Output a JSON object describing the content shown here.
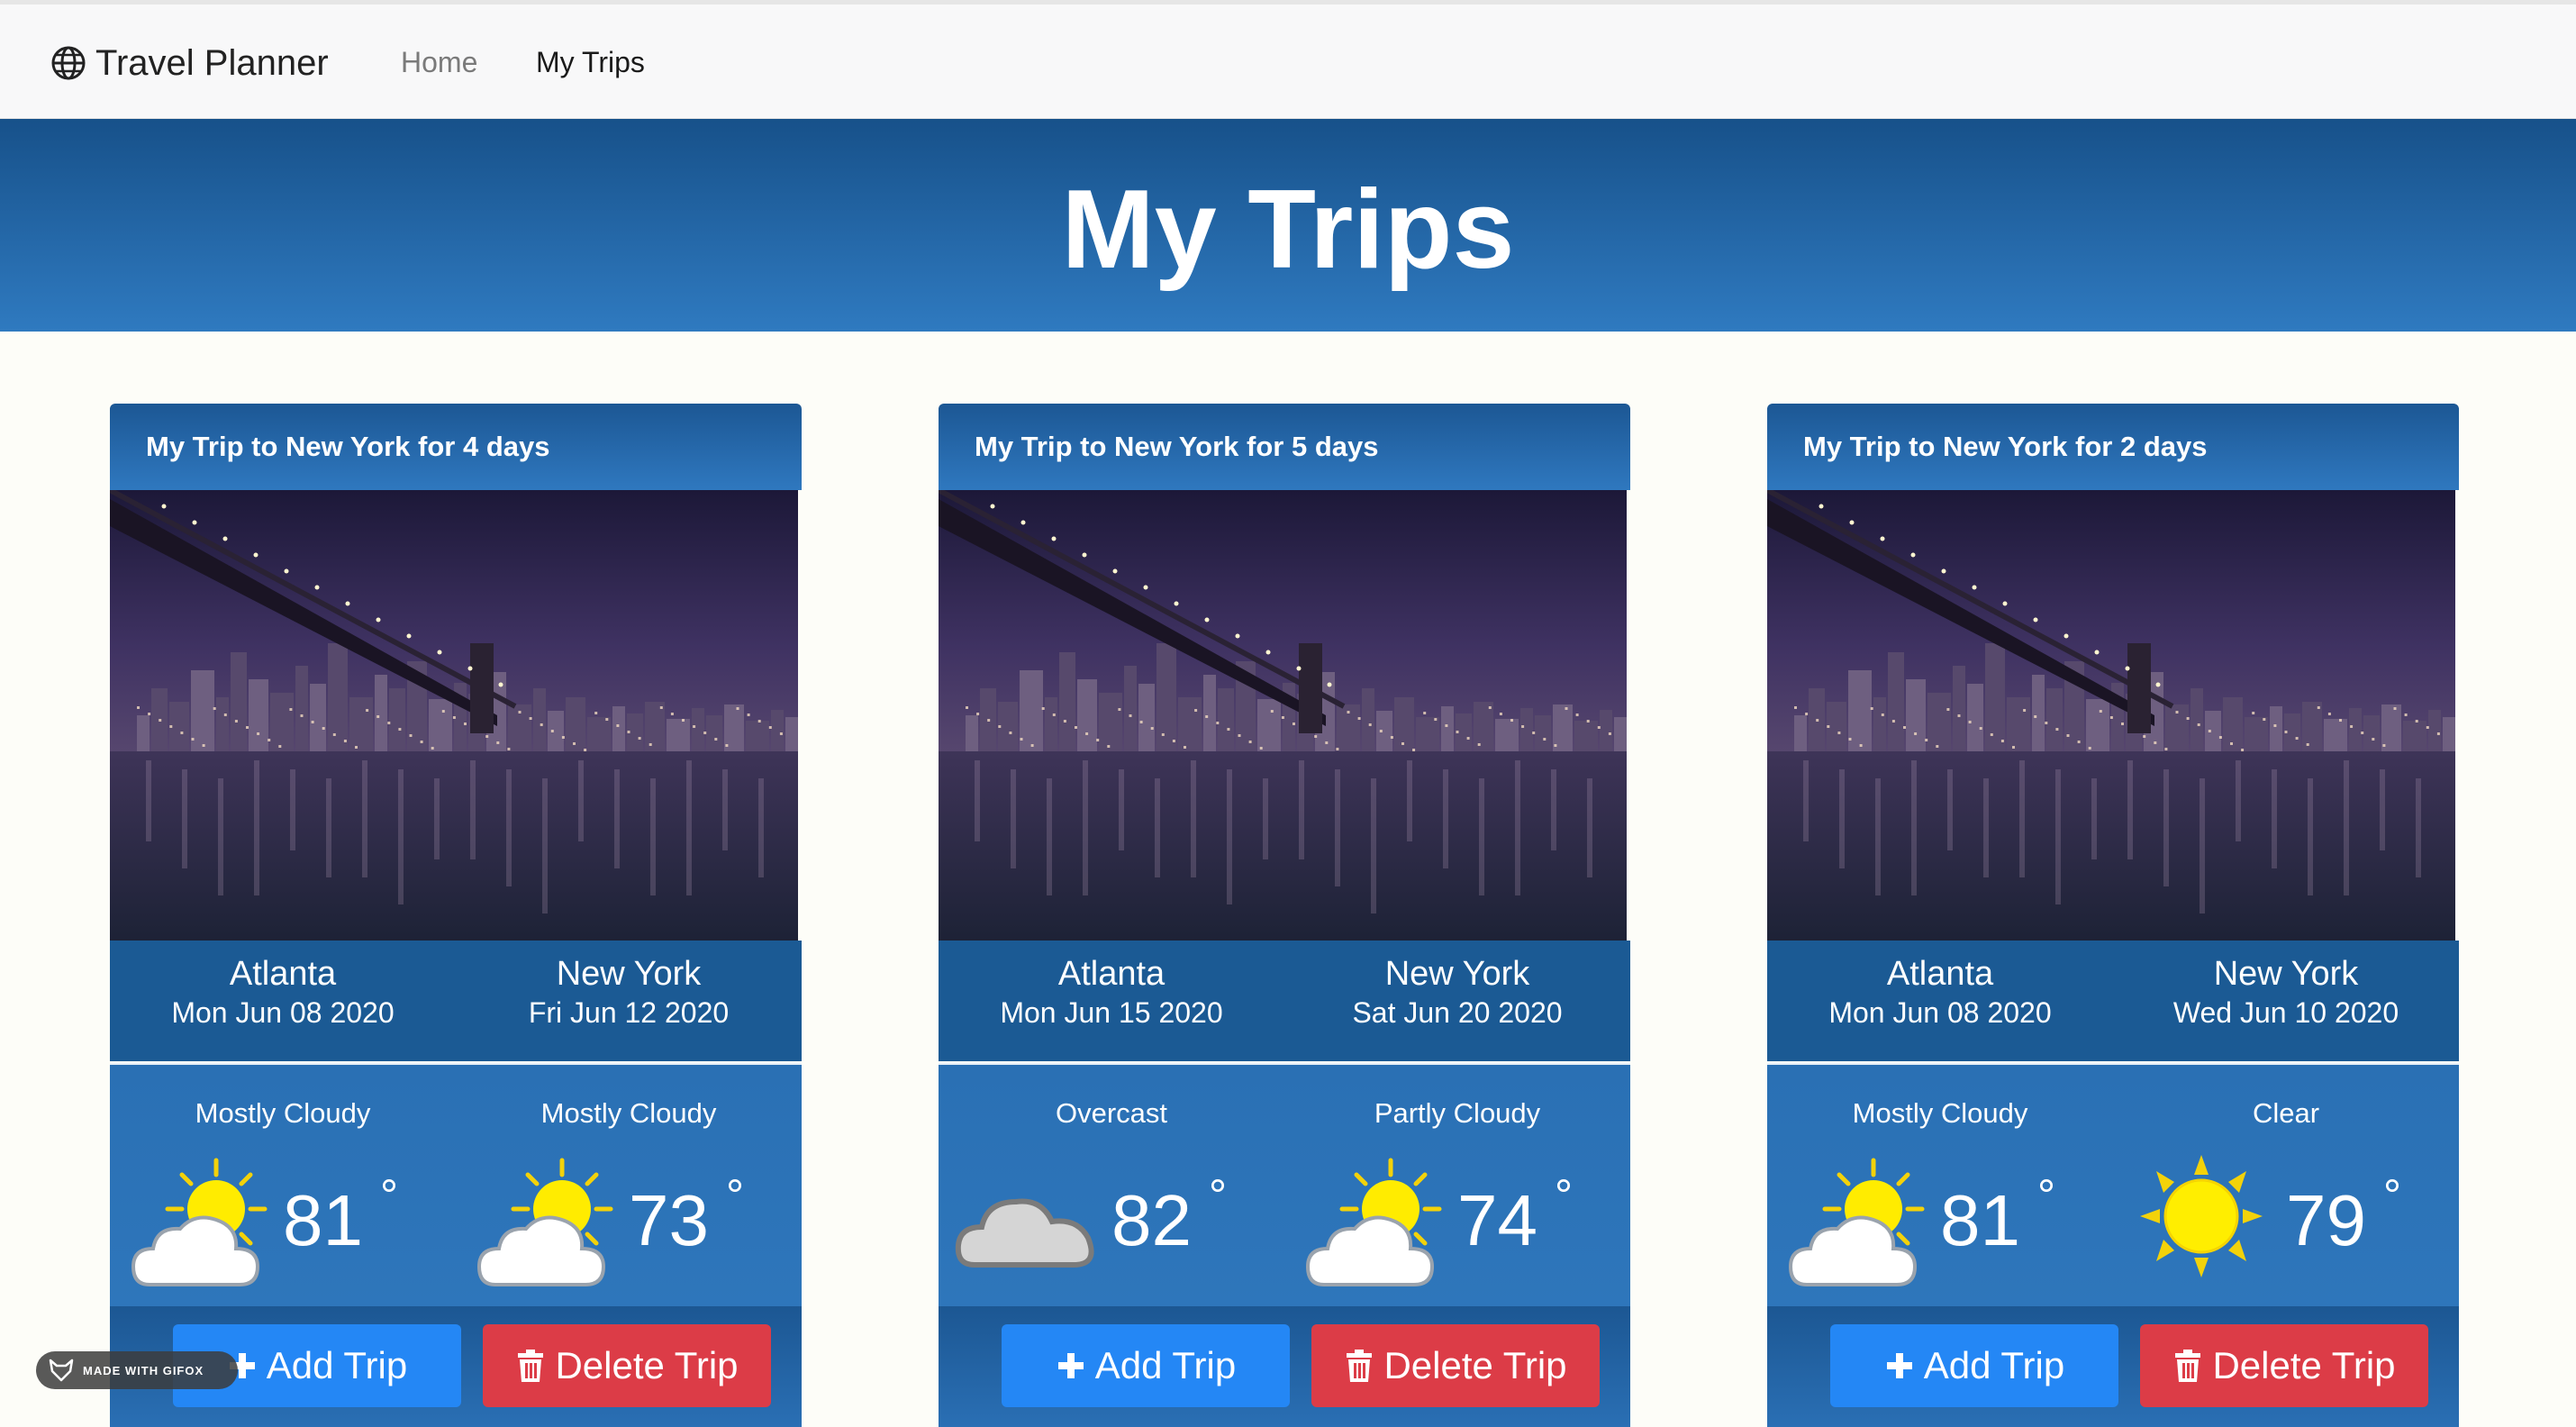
{
  "app": {
    "brand": "Travel Planner",
    "brand_icon": "globe-icon"
  },
  "nav": {
    "home": "Home",
    "my_trips": "My Trips"
  },
  "hero": {
    "title": "My Trips"
  },
  "colors": {
    "header_blue": "#1b5a94",
    "add_button": "#2487f5",
    "delete_button": "#dc3c47"
  },
  "trips": [
    {
      "title": "My Trip to New York for 4 days",
      "origin": {
        "city": "Atlanta",
        "date": "Mon Jun 08 2020",
        "condition": "Mostly Cloudy",
        "temp": "81",
        "icon": "sun-behind-cloud-icon"
      },
      "destination": {
        "city": "New York",
        "date": "Fri Jun 12 2020",
        "condition": "Mostly Cloudy",
        "temp": "73",
        "icon": "sun-behind-cloud-icon"
      },
      "add_label": "Add Trip",
      "delete_label": "Delete Trip"
    },
    {
      "title": "My Trip to New York for 5 days",
      "origin": {
        "city": "Atlanta",
        "date": "Mon Jun 15 2020",
        "condition": "Overcast",
        "temp": "82",
        "icon": "cloud-icon"
      },
      "destination": {
        "city": "New York",
        "date": "Sat Jun 20 2020",
        "condition": "Partly Cloudy",
        "temp": "74",
        "icon": "sun-behind-cloud-icon"
      },
      "add_label": "Add Trip",
      "delete_label": "Delete Trip"
    },
    {
      "title": "My Trip to New York for 2 days",
      "origin": {
        "city": "Atlanta",
        "date": "Mon Jun 08 2020",
        "condition": "Mostly Cloudy",
        "temp": "81",
        "icon": "sun-behind-cloud-icon"
      },
      "destination": {
        "city": "New York",
        "date": "Wed Jun 10 2020",
        "condition": "Clear",
        "temp": "79",
        "icon": "sun-icon"
      },
      "add_label": "Add Trip",
      "delete_label": "Delete Trip"
    }
  ],
  "degree_symbol": "°",
  "watermark": "MADE WITH GIFOX"
}
